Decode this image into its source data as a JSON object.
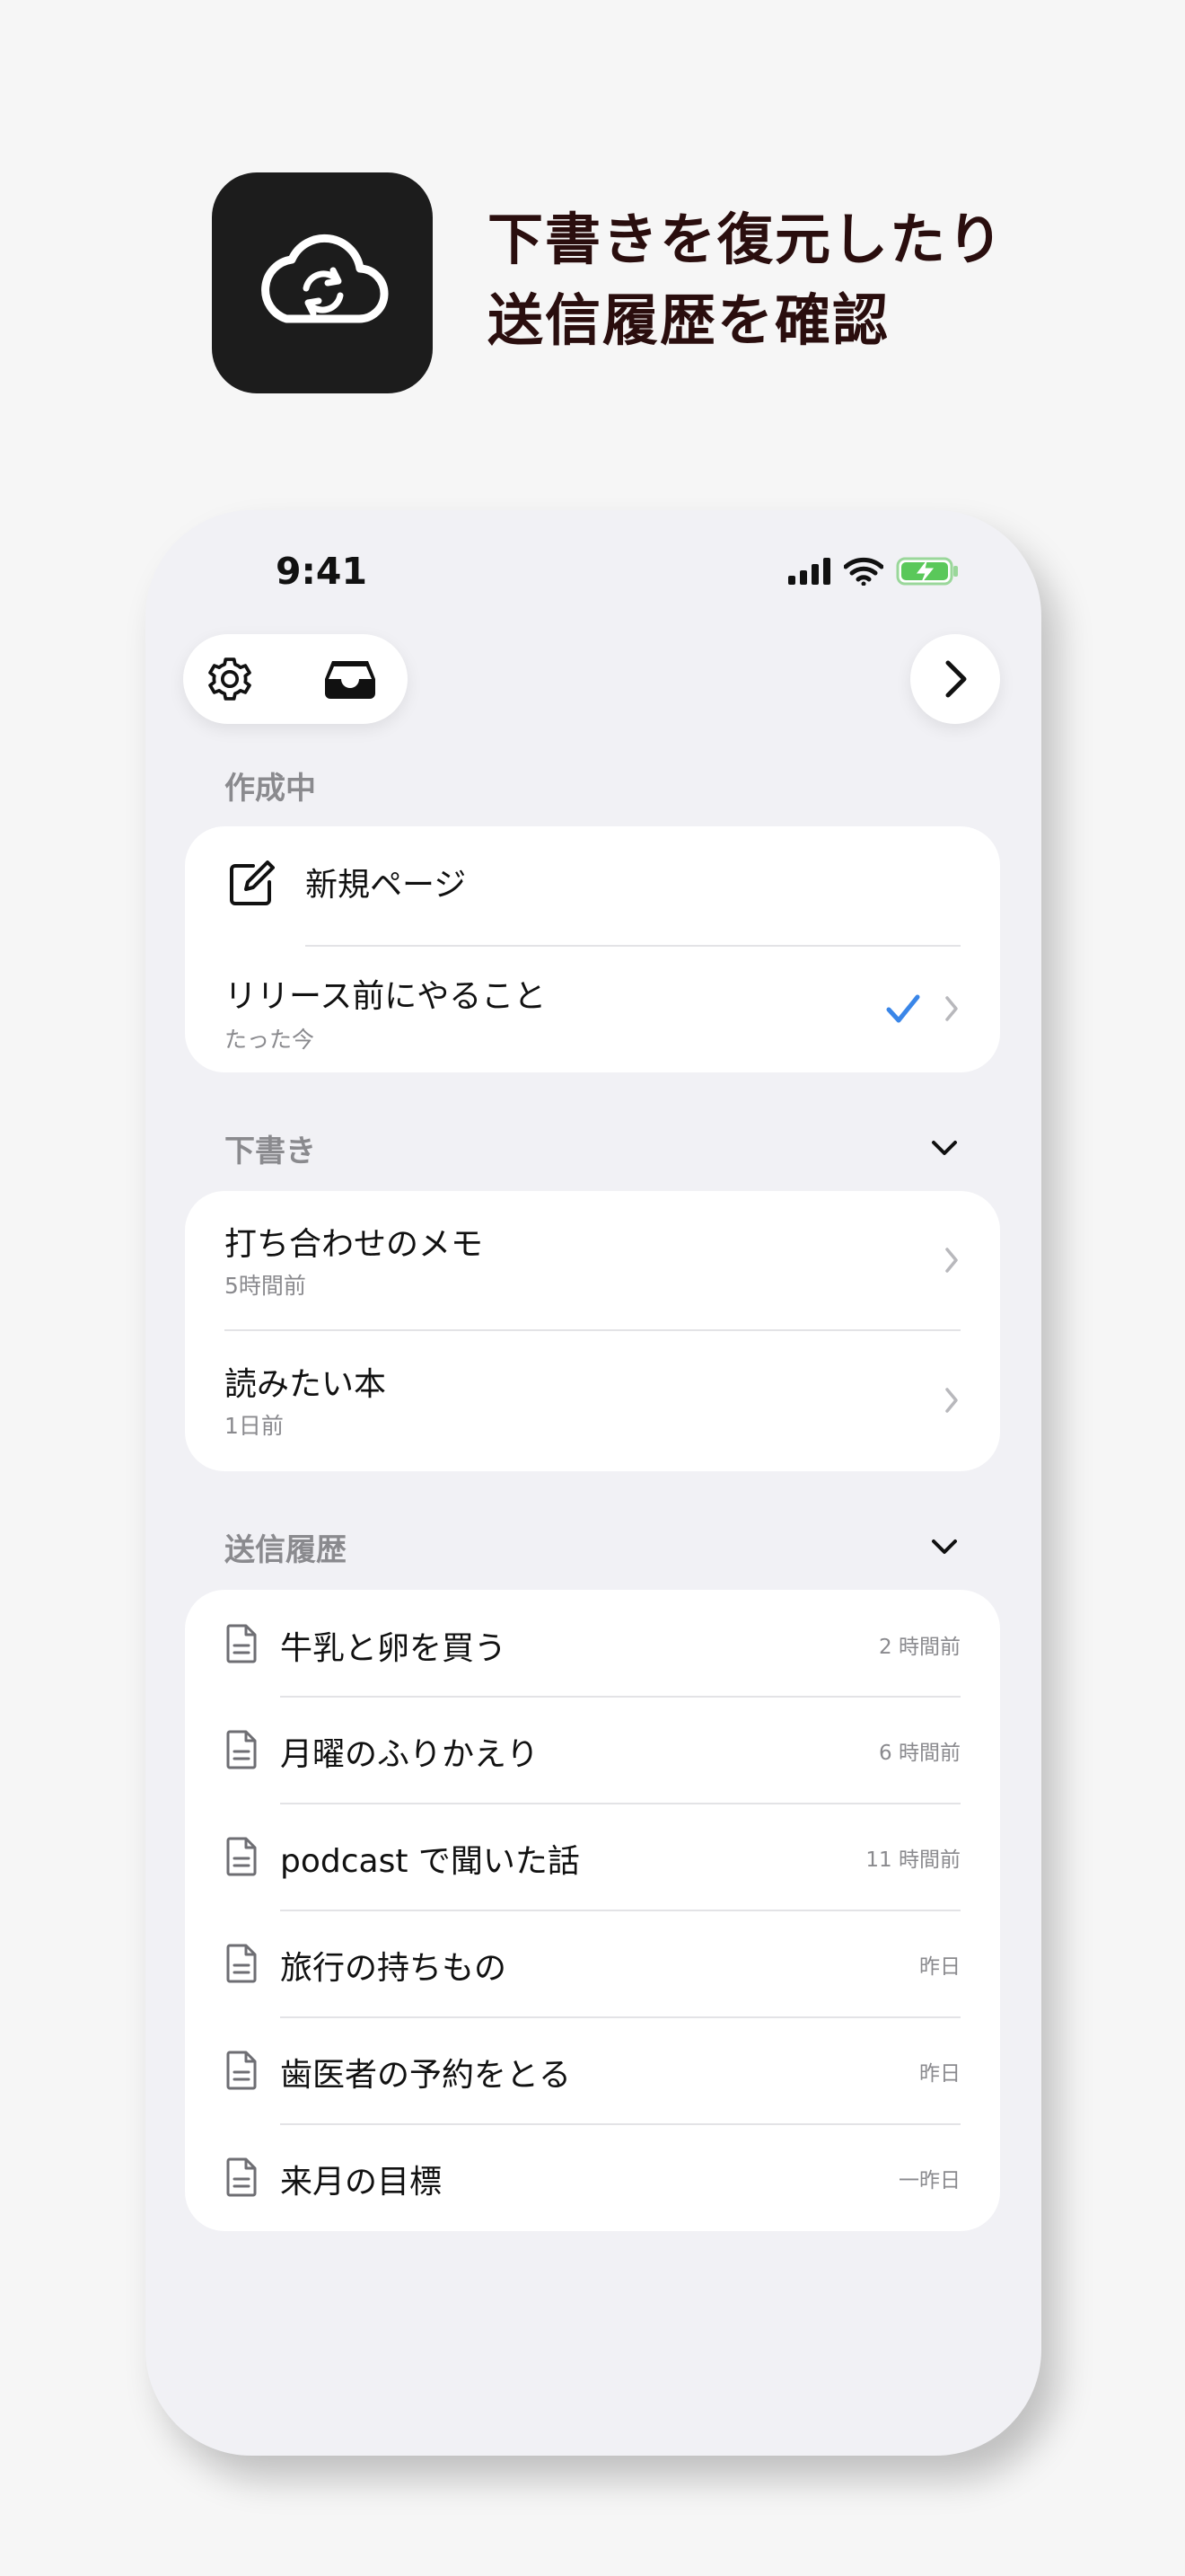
{
  "promo": {
    "headline_line1": "下書きを復元したり",
    "headline_line2": "送信履歴を確認",
    "app_icon": "cloud-sync-icon"
  },
  "status_bar": {
    "time": "9:41",
    "icons": [
      "cellular-signal-icon",
      "wifi-icon",
      "battery-charging-icon"
    ],
    "battery_color": "#5ac85a"
  },
  "toolbar": {
    "left_icons": [
      "gear-icon",
      "inbox-tray-icon"
    ],
    "right_icon": "chevron-right-icon"
  },
  "composing": {
    "header": "作成中",
    "new_page_label": "新規ページ",
    "current": {
      "title": "リリース前にやること",
      "subtitle": "たった今"
    },
    "check_color": "#3a86e8"
  },
  "drafts": {
    "header": "下書き",
    "items": [
      {
        "title": "打ち合わせのメモ",
        "subtitle": "5時間前"
      },
      {
        "title": "読みたい本",
        "subtitle": "1日前"
      }
    ]
  },
  "history": {
    "header": "送信履歴",
    "items": [
      {
        "title": "牛乳と卵を買う",
        "time": "2 時間前"
      },
      {
        "title": "月曜のふりかえり",
        "time": "6 時間前"
      },
      {
        "title": "podcast で聞いた話",
        "time": "11 時間前"
      },
      {
        "title": "旅行の持ちもの",
        "time": "昨日"
      },
      {
        "title": "歯医者の予約をとる",
        "time": "昨日"
      },
      {
        "title": "来月の目標",
        "time": "一昨日"
      }
    ]
  }
}
